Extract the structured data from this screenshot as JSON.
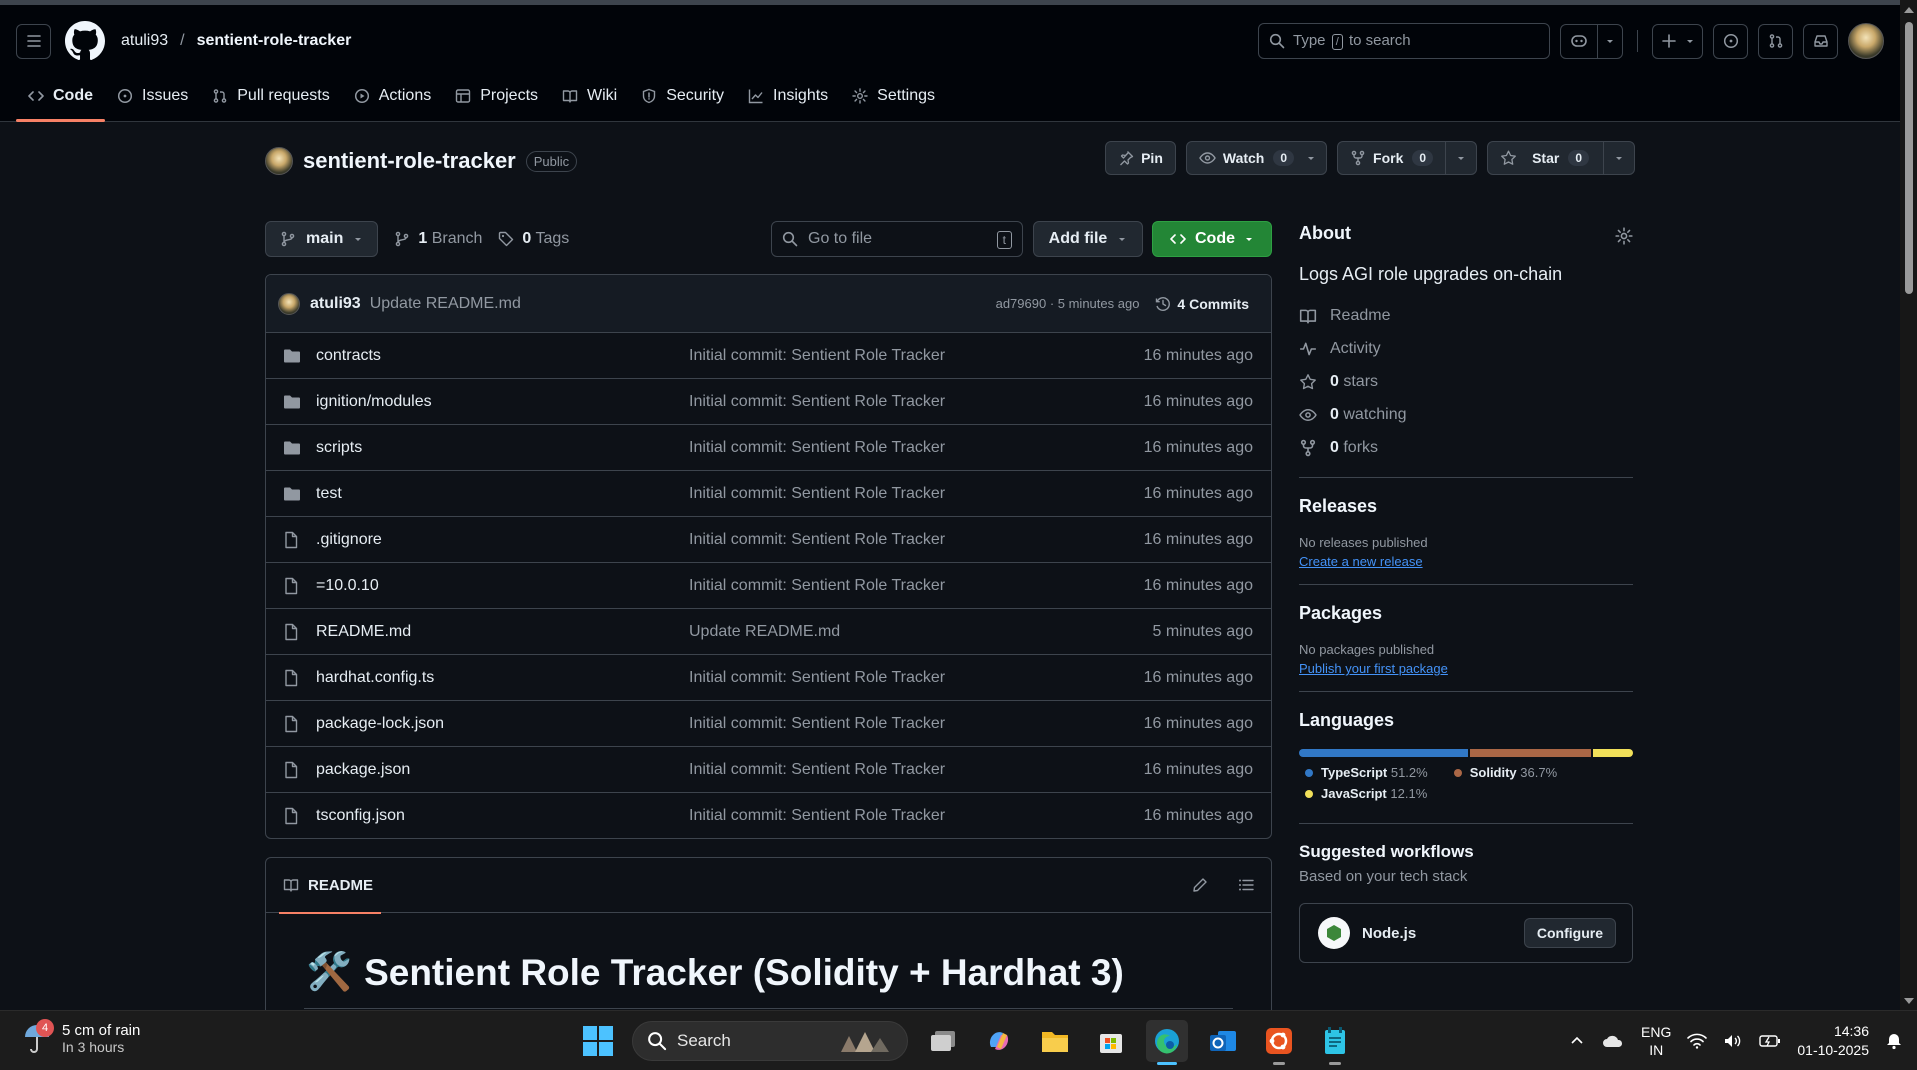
{
  "header": {
    "owner": "atuli93",
    "separator": "/",
    "repo": "sentient-role-tracker",
    "search_pre": "Type",
    "search_key": "/",
    "search_post": "to search"
  },
  "tabs": [
    {
      "label": "Code",
      "icon": "code-icon"
    },
    {
      "label": "Issues",
      "icon": "issue-icon"
    },
    {
      "label": "Pull requests",
      "icon": "pull-request-icon"
    },
    {
      "label": "Actions",
      "icon": "play-icon"
    },
    {
      "label": "Projects",
      "icon": "table-icon"
    },
    {
      "label": "Wiki",
      "icon": "book-icon"
    },
    {
      "label": "Security",
      "icon": "shield-icon"
    },
    {
      "label": "Insights",
      "icon": "graph-icon"
    },
    {
      "label": "Settings",
      "icon": "gear-icon"
    }
  ],
  "repo_head": {
    "title": "sentient-role-tracker",
    "visibility": "Public",
    "pin": "Pin",
    "watch": "Watch",
    "watch_count": "0",
    "fork": "Fork",
    "fork_count": "0",
    "star": "Star",
    "star_count": "0"
  },
  "toolbar": {
    "branch": "main",
    "branches_count": "1",
    "branches_label": "Branch",
    "tags_count": "0",
    "tags_label": "Tags",
    "goto_placeholder": "Go to file",
    "goto_key": "t",
    "add_file": "Add file",
    "code": "Code"
  },
  "commit": {
    "author": "atuli93",
    "message": "Update README.md",
    "info": "ad79690 · 5 minutes ago",
    "commits": "4 Commits"
  },
  "files": [
    {
      "name": "contracts",
      "type": "dir",
      "message": "Initial commit: Sentient Role Tracker",
      "time": "16 minutes ago"
    },
    {
      "name": "ignition/modules",
      "type": "dir",
      "message": "Initial commit: Sentient Role Tracker",
      "time": "16 minutes ago"
    },
    {
      "name": "scripts",
      "type": "dir",
      "message": "Initial commit: Sentient Role Tracker",
      "time": "16 minutes ago"
    },
    {
      "name": "test",
      "type": "dir",
      "message": "Initial commit: Sentient Role Tracker",
      "time": "16 minutes ago"
    },
    {
      "name": ".gitignore",
      "type": "file",
      "message": "Initial commit: Sentient Role Tracker",
      "time": "16 minutes ago"
    },
    {
      "name": "=10.0.10",
      "type": "file",
      "message": "Initial commit: Sentient Role Tracker",
      "time": "16 minutes ago"
    },
    {
      "name": "README.md",
      "type": "file",
      "message": "Update README.md",
      "time": "5 minutes ago"
    },
    {
      "name": "hardhat.config.ts",
      "type": "file",
      "message": "Initial commit: Sentient Role Tracker",
      "time": "16 minutes ago"
    },
    {
      "name": "package-lock.json",
      "type": "file",
      "message": "Initial commit: Sentient Role Tracker",
      "time": "16 minutes ago"
    },
    {
      "name": "package.json",
      "type": "file",
      "message": "Initial commit: Sentient Role Tracker",
      "time": "16 minutes ago"
    },
    {
      "name": "tsconfig.json",
      "type": "file",
      "message": "Initial commit: Sentient Role Tracker",
      "time": "16 minutes ago"
    }
  ],
  "readme": {
    "tab": "README",
    "emoji": "🛠️",
    "heading": "Sentient Role Tracker (Solidity + Hardhat 3)"
  },
  "about": {
    "title": "About",
    "description": "Logs AGI role upgrades on-chain",
    "readme": "Readme",
    "activity": "Activity",
    "stars_count": "0",
    "stars_label": "stars",
    "watching_count": "0",
    "watching_label": "watching",
    "forks_count": "0",
    "forks_label": "forks"
  },
  "releases": {
    "title": "Releases",
    "empty": "No releases published",
    "link": "Create a new release"
  },
  "packages": {
    "title": "Packages",
    "empty": "No packages published",
    "link": "Publish your first package"
  },
  "languages": {
    "title": "Languages",
    "items": [
      {
        "name": "TypeScript",
        "percent": "51.2%",
        "value": 51.2,
        "color": "#3178c6"
      },
      {
        "name": "Solidity",
        "percent": "36.7%",
        "value": 36.7,
        "color": "#aa6746"
      },
      {
        "name": "JavaScript",
        "percent": "12.1%",
        "value": 12.1,
        "color": "#f1e05a"
      }
    ]
  },
  "workflows": {
    "title": "Suggested workflows",
    "subtitle": "Based on your tech stack",
    "name": "Node.js",
    "button": "Configure"
  },
  "taskbar": {
    "weather_badge": "4",
    "weather_title": "5 cm of rain",
    "weather_sub": "In 3 hours",
    "search": "Search",
    "lang1": "ENG",
    "lang2": "IN",
    "time": "14:36",
    "date": "01-10-2025"
  }
}
